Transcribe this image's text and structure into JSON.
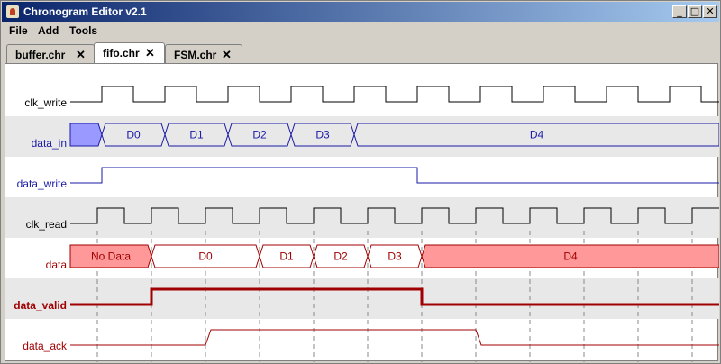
{
  "window": {
    "title": "Chronogram Editor v2.1",
    "minimize": "_",
    "maximize": "□",
    "close": "✕"
  },
  "menu": [
    "File",
    "Add",
    "Tools"
  ],
  "tabs": [
    {
      "label": "buffer.chr",
      "close": "✕",
      "active": false
    },
    {
      "label": "fifo.chr",
      "close": "✕",
      "active": true
    },
    {
      "label": "FSM.chr",
      "close": "✕",
      "active": false
    }
  ],
  "colors": {
    "blue": "#1a1aa6",
    "red": "#a00000",
    "row_shade": "#e8e8e8",
    "data_red_fill": "#ff9999",
    "data_blue_fill": "#9999ff"
  },
  "signals": [
    {
      "name": "clk_write",
      "type": "clock",
      "color": "black",
      "bold": false,
      "shaded": false
    },
    {
      "name": "data_in",
      "type": "bus",
      "color": "blue",
      "bold": false,
      "shaded": true,
      "values": [
        "",
        "D0",
        "D1",
        "D2",
        "D3",
        "D4"
      ]
    },
    {
      "name": "data_write",
      "type": "bit",
      "color": "blue",
      "bold": false,
      "shaded": false
    },
    {
      "name": "clk_read",
      "type": "clock",
      "color": "black",
      "bold": false,
      "shaded": true
    },
    {
      "name": "data",
      "type": "bus",
      "color": "red",
      "bold": false,
      "shaded": false,
      "values": [
        "No Data",
        "D0",
        "D1",
        "D2",
        "D3",
        "D4"
      ]
    },
    {
      "name": "data_valid",
      "type": "bit",
      "color": "red",
      "bold": true,
      "shaded": true
    },
    {
      "name": "data_ack",
      "type": "bit",
      "color": "red",
      "bold": false,
      "shaded": false
    }
  ]
}
